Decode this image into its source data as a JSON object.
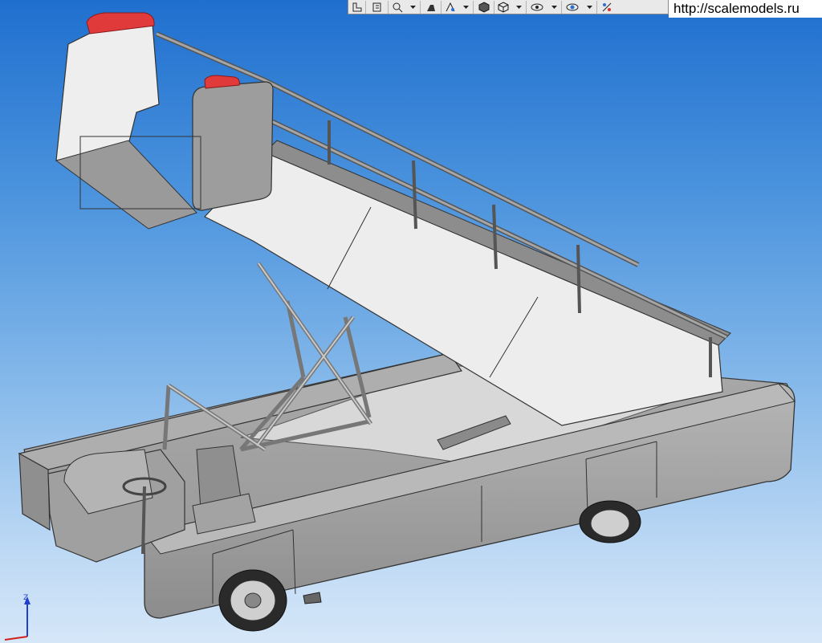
{
  "toolbar": {
    "buttons": [
      {
        "icon": "section-view-icon"
      },
      {
        "icon": "view-orientation-icon"
      },
      {
        "icon": "zoom-icon",
        "dropdown": true
      },
      {
        "icon": "display-style-icon"
      },
      {
        "icon": "hide-show-icon",
        "dropdown": true
      },
      {
        "icon": "shaded-edges-icon"
      },
      {
        "icon": "shaded-icon",
        "dropdown": true
      },
      {
        "icon": "visibility-icon",
        "dropdown": true
      },
      {
        "icon": "appearance-icon",
        "dropdown": true
      },
      {
        "icon": "scene-icon"
      }
    ]
  },
  "watermark": {
    "text": "http://scalemodels.ru"
  },
  "axis": {
    "label": "Z"
  },
  "colors": {
    "body": "#9a9a9a",
    "body_light": "#b3b3b3",
    "panel_white": "#ececec",
    "accent_red": "#e03a3a"
  }
}
